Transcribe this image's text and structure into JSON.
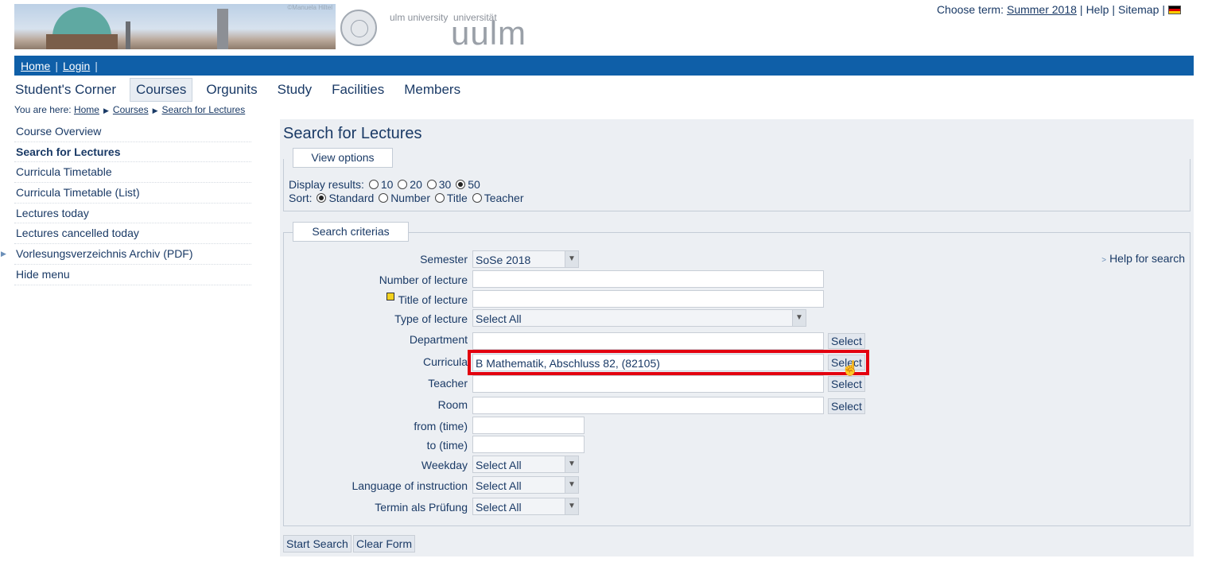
{
  "header": {
    "banner_credit": "©Manuela Hiltel",
    "logo_en": "ulm university",
    "logo_de": "universität",
    "logo_mark": "uulm",
    "choose_term_label": "Choose term:",
    "term_value": "Summer 2018",
    "help": "Help",
    "sitemap": "Sitemap",
    "language_icon": "german-flag-icon"
  },
  "bluebar": {
    "home": "Home",
    "login": "Login"
  },
  "mainnav": [
    "Student's Corner",
    "Courses",
    "Orgunits",
    "Study",
    "Facilities",
    "Members"
  ],
  "breadcrumb": {
    "prefix": "You are here:",
    "items": [
      "Home",
      "Courses",
      "Search for Lectures"
    ]
  },
  "sidebar": {
    "items": [
      "Course Overview",
      "Search for Lectures",
      "Curricula Timetable",
      "Curricula Timetable (List)",
      "Lectures today",
      "Lectures cancelled today",
      "Vorlesungsverzeichnis Archiv (PDF)",
      "Hide menu"
    ]
  },
  "main": {
    "title": "Search for Lectures",
    "view_options": {
      "legend": "View options",
      "display_label": "Display results:",
      "display_options": [
        "10",
        "20",
        "30",
        "50"
      ],
      "display_selected": "50",
      "sort_label": "Sort:",
      "sort_options": [
        "Standard",
        "Number",
        "Title",
        "Teacher"
      ],
      "sort_selected": "Standard"
    },
    "criteria": {
      "legend": "Search criterias",
      "help_link": "Help for search",
      "semester_label": "Semester",
      "semester_value": "SoSe 2018",
      "number_label": "Number of lecture",
      "number_value": "",
      "title_label": "Title of lecture",
      "title_value": "",
      "type_label": "Type of lecture",
      "type_value": "Select All",
      "department_label": "Department",
      "department_value": "",
      "curricula_label": "Curricula",
      "curricula_value": "B Mathematik, Abschluss 82, (82105)",
      "teacher_label": "Teacher",
      "teacher_value": "",
      "room_label": "Room",
      "room_value": "",
      "from_label": "from (time)",
      "from_value": "",
      "to_label": "to (time)",
      "to_value": "",
      "weekday_label": "Weekday",
      "weekday_value": "Select All",
      "language_label": "Language of instruction",
      "language_value": "Select All",
      "exam_label": "Termin als Prüfung",
      "exam_value": "Select All",
      "select_button": "Select"
    },
    "actions": {
      "start": "Start Search",
      "clear": "Clear Form"
    }
  },
  "colors": {
    "brand_blue": "#0f5fa8",
    "text": "#1a3a66",
    "highlight": "#e3000f"
  }
}
